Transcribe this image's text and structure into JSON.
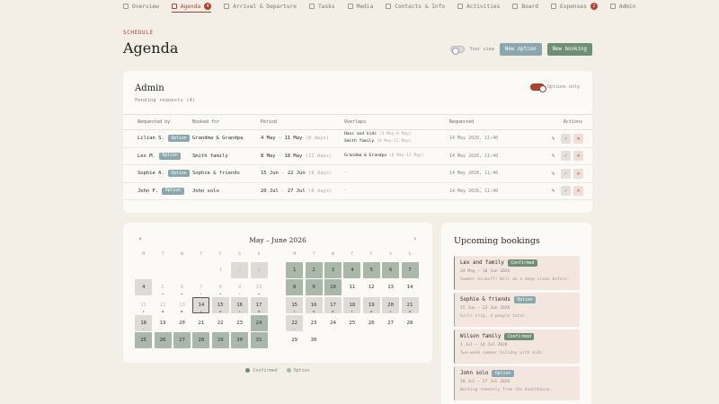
{
  "nav": {
    "items": [
      {
        "label": "Overview",
        "icon": "grid-icon",
        "badge": ""
      },
      {
        "label": "Agenda",
        "icon": "calendar-icon",
        "badge": "4"
      },
      {
        "label": "Arrival & Departure",
        "icon": "suitcase-icon",
        "badge": ""
      },
      {
        "label": "Tasks",
        "icon": "wrench-icon",
        "badge": ""
      },
      {
        "label": "Media",
        "icon": "image-icon",
        "badge": ""
      },
      {
        "label": "Contacts & Info",
        "icon": "pin-icon",
        "badge": ""
      },
      {
        "label": "Activities",
        "icon": "compass-icon",
        "badge": ""
      },
      {
        "label": "Board",
        "icon": "board-icon",
        "badge": ""
      },
      {
        "label": "Expenses",
        "icon": "receipt-icon",
        "badge": "2"
      },
      {
        "label": "Admin",
        "icon": "shield-icon",
        "badge": ""
      }
    ]
  },
  "header": {
    "eyebrow": "SCHEDULE",
    "title": "Agenda",
    "your_view_label": "Your view",
    "new_option": "New option",
    "new_booking": "New booking"
  },
  "admin": {
    "title": "Admin",
    "subtitle": "Pending requests (4)",
    "options_only": "Options only",
    "columns": [
      "Requested by",
      "Booked for",
      "Period",
      "Overlaps",
      "Requested",
      "Actions"
    ],
    "rows": [
      {
        "by": "Lilian S.",
        "status": "Option",
        "for": "Grandma & Grandpa",
        "from": "4 May",
        "to": "11 May",
        "days": "(8 days)",
        "overlaps": [
          {
            "name": "Hans and kids",
            "range": "(4 May–4 May)"
          },
          {
            "name": "Smith family",
            "range": "(8 May–11 May)"
          }
        ],
        "requested": "14 May 2026, 11:40"
      },
      {
        "by": "Lex M.",
        "status": "Option",
        "for": "Smith family",
        "from": "8 May",
        "to": "18 May",
        "days": "(11 days)",
        "overlaps": [
          {
            "name": "Grandma & Grandpa",
            "range": "(8 May–11 May)"
          }
        ],
        "requested": "14 May 2026, 11:40"
      },
      {
        "by": "Sophie A.",
        "status": "Option",
        "for": "Sophie & friends",
        "from": "15 Jun",
        "to": "22 Jun",
        "days": "(8 days)",
        "overlaps": [
          {
            "name": "–",
            "range": ""
          }
        ],
        "requested": "14 May 2026, 11:40"
      },
      {
        "by": "John F.",
        "status": "Option",
        "for": "John solo",
        "from": "20 Jul",
        "to": "27 Jul",
        "days": "(8 days)",
        "overlaps": [
          {
            "name": "–",
            "range": ""
          }
        ],
        "requested": "14 May 2026, 11:40"
      }
    ]
  },
  "calendar": {
    "title": "May – June 2026",
    "weekdays": [
      "M",
      "T",
      "W",
      "T",
      "F",
      "S",
      "S"
    ]
  },
  "legend": {
    "confirmed": "Confirmed",
    "option": "Option",
    "confirmed_color": "#6f8f74",
    "option_color": "#a9b8a9"
  },
  "upcoming": {
    "title": "Upcoming bookings",
    "items": [
      {
        "name": "Lex and family",
        "status": "Confirmed",
        "dates": "24 May – 10 Jun 2026",
        "note": "Summer kickoff! Will do a deep clean before."
      },
      {
        "name": "Sophie & friends",
        "status": "Option",
        "dates": "15 Jun – 22 Jun 2026",
        "note": "Girls trip, 4 people total."
      },
      {
        "name": "Wilson family",
        "status": "Confirmed",
        "dates": "1 Jul – 14 Jul 2026",
        "note": "Two-week summer holiday with kids."
      },
      {
        "name": "John solo",
        "status": "Option",
        "dates": "20 Jul – 27 Jul 2026",
        "note": "Working remotely from the beachhouse."
      }
    ]
  }
}
